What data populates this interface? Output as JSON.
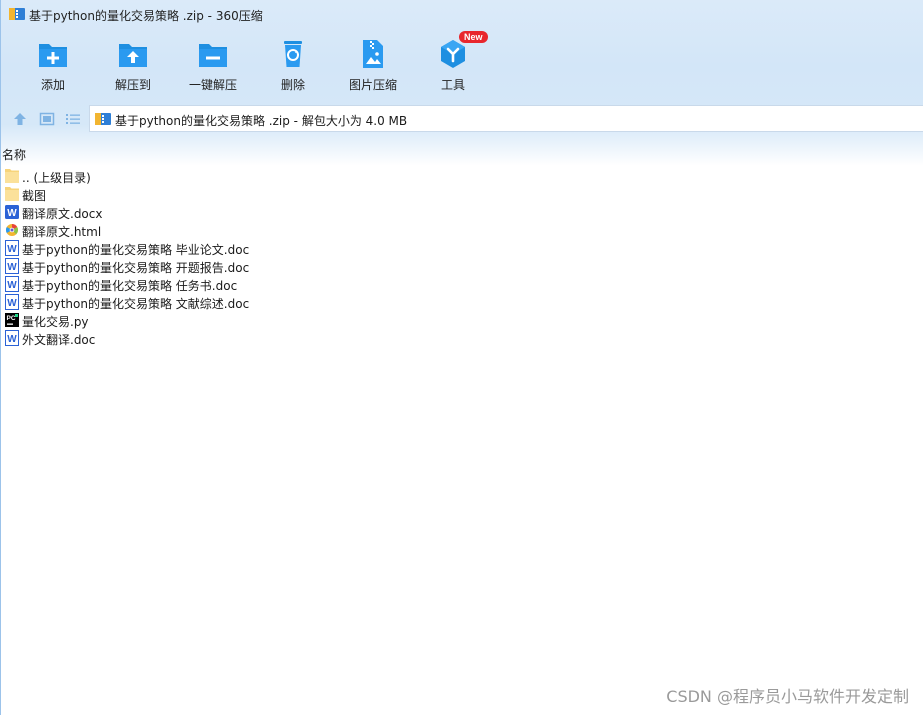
{
  "window": {
    "title": "基于python的量化交易策略 .zip - 360压缩"
  },
  "toolbar": {
    "items": [
      {
        "label": "添加",
        "icon": "add-icon"
      },
      {
        "label": "解压到",
        "icon": "extract-to-icon"
      },
      {
        "label": "一键解压",
        "icon": "one-click-extract-icon"
      },
      {
        "label": "删除",
        "icon": "delete-icon"
      },
      {
        "label": "图片压缩",
        "icon": "image-compress-icon"
      },
      {
        "label": "工具",
        "icon": "tools-icon",
        "badge": "New"
      }
    ],
    "accent_color": "#1e8fe1"
  },
  "address": {
    "text": "基于python的量化交易策略 .zip - 解包大小为 4.0 MB"
  },
  "list": {
    "column_name": "名称",
    "files": [
      {
        "name": ".. (上级目录)",
        "icon": "folder-icon"
      },
      {
        "name": "截图",
        "icon": "folder-icon"
      },
      {
        "name": "翻译原文.docx",
        "icon": "word-docx-icon"
      },
      {
        "name": "翻译原文.html",
        "icon": "browser-html-icon"
      },
      {
        "name": "基于python的量化交易策略 毕业论文.doc",
        "icon": "word-doc-icon"
      },
      {
        "name": "基于python的量化交易策略 开题报告.doc",
        "icon": "word-doc-icon"
      },
      {
        "name": "基于python的量化交易策略 任务书.doc",
        "icon": "word-doc-icon"
      },
      {
        "name": "基于python的量化交易策略 文献综述.doc",
        "icon": "word-doc-icon"
      },
      {
        "name": "量化交易.py",
        "icon": "pycharm-icon"
      },
      {
        "name": "外文翻译.doc",
        "icon": "word-doc-icon"
      }
    ]
  },
  "watermark": "CSDN @程序员小马软件开发定制"
}
